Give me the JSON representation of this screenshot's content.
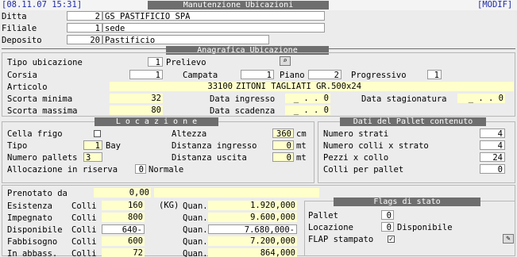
{
  "header": {
    "date": "[08.11.07 15:31]",
    "title": "Manutenzione Ubicazioni",
    "mode": "[MODIF]"
  },
  "top": {
    "ditta_label": "Ditta",
    "ditta_code": "2",
    "ditta_name": "GS PASTIFICIO SPA",
    "filiale_label": "Filiale",
    "filiale_code": "1",
    "filiale_name": "sede",
    "deposito_label": "Deposito",
    "deposito_code": "20",
    "deposito_name": "Pastificio"
  },
  "anagrafica": {
    "title": "Anagrafica  Ubicazione",
    "tipo_label": "Tipo ubicazione",
    "tipo_value": "1",
    "tipo_desc": "Prelievo",
    "corsia_label": "Corsia",
    "corsia_value": "1",
    "campata_label": "Campata",
    "campata_value": "1",
    "piano_label": "Piano",
    "piano_value": "2",
    "progressivo_label": "Progressivo",
    "progressivo_value": "1",
    "articolo_label": "Articolo",
    "articolo_code": "33100",
    "articolo_desc": "ZITONI TAGLIATI   GR.500x24",
    "scorta_min_label": "Scorta minima",
    "scorta_min_value": "32",
    "scorta_max_label": "Scorta massima",
    "scorta_max_value": "80",
    "data_ingresso_label": "Data ingresso",
    "data_ingresso_value": "_ . . 0",
    "data_scadenza_label": "Data scadenza",
    "data_scadenza_value": "_ . . 0",
    "data_stag_label": "Data stagionatura",
    "data_stag_value": "_ . . 0"
  },
  "locazione": {
    "title": "L o c a z i o n e",
    "cella_label": "Cella frigo",
    "tipo_label": "Tipo",
    "tipo_value": "1",
    "tipo_desc": "Bay",
    "npallets_label": "Numero pallets",
    "npallets_value": "3",
    "alloc_label": "Allocazione in riserva",
    "alloc_value": "0",
    "alloc_desc": "Normale",
    "altezza_label": "Altezza",
    "altezza_value": "360",
    "altezza_unit": "cm",
    "dist_in_label": "Distanza ingresso",
    "dist_in_value": "0",
    "dist_in_unit": "mt",
    "dist_out_label": "Distanza uscita",
    "dist_out_value": "0",
    "dist_out_unit": "mt"
  },
  "pallet": {
    "title": "Dati del Pallet contenuto",
    "strati_label": "Numero strati",
    "strati_value": "4",
    "colli_strato_label": "Numero colli x strato",
    "colli_strato_value": "4",
    "pezzi_label": "Pezzi x collo",
    "pezzi_value": "24",
    "colli_pallet_label": "Colli per pallet",
    "colli_pallet_value": "0"
  },
  "giacenze": {
    "prenotato_label": "Prenotato da",
    "prenotato_value": "0,00",
    "colli_label": "Colli",
    "quan_label": "Quan.",
    "kg_label": "(KG)",
    "rows": [
      {
        "label": "Esistenza",
        "colli": "160",
        "quan": "1.920,000"
      },
      {
        "label": "Impegnato",
        "colli": "800",
        "quan": "9.600,000"
      },
      {
        "label": "Disponibile",
        "colli": "640-",
        "quan": "7.680,000-"
      },
      {
        "label": "Fabbisogno",
        "colli": "600",
        "quan": "7.200,000"
      },
      {
        "label": "In abbass.",
        "colli": "72",
        "quan": "864,000"
      }
    ]
  },
  "flags": {
    "title": "Flags di stato",
    "pallet_label": "Pallet",
    "pallet_value": "0",
    "locazione_label": "Locazione",
    "locazione_value": "0",
    "locazione_desc": "Disponibile",
    "flap_label": "FLAP stampato"
  },
  "colors": {
    "section_bar": "#6e6e6e",
    "input_yellow": "#ffffcc",
    "header_blue": "#1e2aa8"
  }
}
